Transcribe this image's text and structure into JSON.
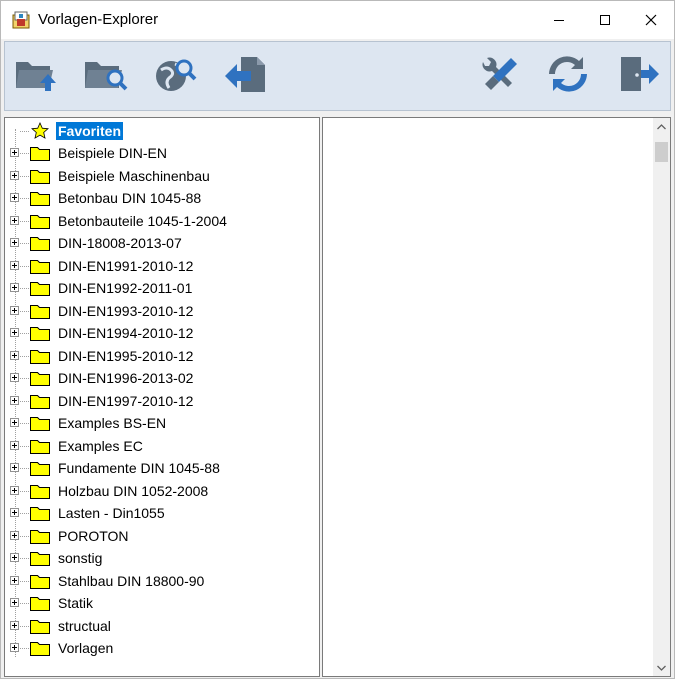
{
  "window": {
    "title": "Vorlagen-Explorer"
  },
  "toolbar": {
    "buttons": [
      {
        "name": "folder-up-button",
        "icon": "folder-up-icon"
      },
      {
        "name": "folder-search-button",
        "icon": "folder-search-icon"
      },
      {
        "name": "web-search-button",
        "icon": "globe-search-icon"
      },
      {
        "name": "export-button",
        "icon": "document-arrow-icon"
      },
      {
        "name": "settings-button",
        "icon": "tools-icon"
      },
      {
        "name": "refresh-button",
        "icon": "refresh-icon"
      },
      {
        "name": "exit-button",
        "icon": "exit-door-icon"
      }
    ]
  },
  "tree": {
    "favorites": "Favoriten",
    "items": [
      "Beispiele DIN-EN",
      "Beispiele Maschinenbau",
      "Betonbau DIN 1045-88",
      "Betonbauteile 1045-1-2004",
      "DIN-18008-2013-07",
      "DIN-EN1991-2010-12",
      "DIN-EN1992-2011-01",
      "DIN-EN1993-2010-12",
      "DIN-EN1994-2010-12",
      "DIN-EN1995-2010-12",
      "DIN-EN1996-2013-02",
      "DIN-EN1997-2010-12",
      "Examples BS-EN",
      "Examples EC",
      "Fundamente DIN 1045-88",
      "Holzbau DIN 1052-2008",
      "Lasten - Din1055",
      "POROTON",
      "sonstig",
      "Stahlbau DIN 18800-90",
      "Statik",
      "structual",
      "Vorlagen"
    ]
  },
  "colors": {
    "selection": "#0078d7",
    "folder": "#ffff00",
    "toolbar_bg": "#dde6f1",
    "icon": "#5a6c7d"
  }
}
